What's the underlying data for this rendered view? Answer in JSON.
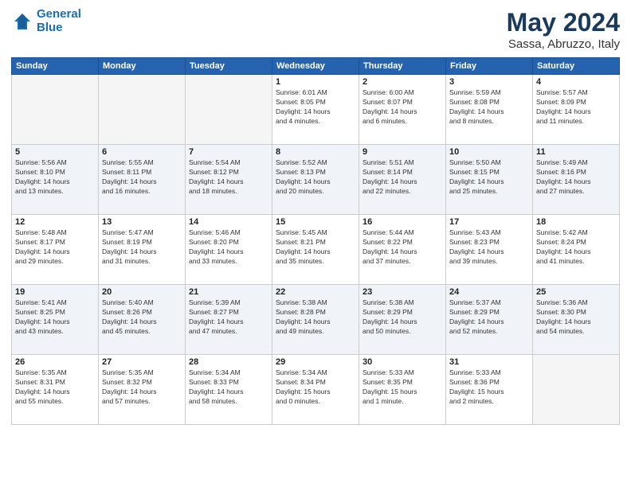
{
  "header": {
    "logo_line1": "General",
    "logo_line2": "Blue",
    "month": "May 2024",
    "location": "Sassa, Abruzzo, Italy"
  },
  "weekdays": [
    "Sunday",
    "Monday",
    "Tuesday",
    "Wednesday",
    "Thursday",
    "Friday",
    "Saturday"
  ],
  "weeks": [
    [
      {
        "day": "",
        "info": ""
      },
      {
        "day": "",
        "info": ""
      },
      {
        "day": "",
        "info": ""
      },
      {
        "day": "1",
        "info": "Sunrise: 6:01 AM\nSunset: 8:05 PM\nDaylight: 14 hours\nand 4 minutes."
      },
      {
        "day": "2",
        "info": "Sunrise: 6:00 AM\nSunset: 8:07 PM\nDaylight: 14 hours\nand 6 minutes."
      },
      {
        "day": "3",
        "info": "Sunrise: 5:59 AM\nSunset: 8:08 PM\nDaylight: 14 hours\nand 8 minutes."
      },
      {
        "day": "4",
        "info": "Sunrise: 5:57 AM\nSunset: 8:09 PM\nDaylight: 14 hours\nand 11 minutes."
      }
    ],
    [
      {
        "day": "5",
        "info": "Sunrise: 5:56 AM\nSunset: 8:10 PM\nDaylight: 14 hours\nand 13 minutes."
      },
      {
        "day": "6",
        "info": "Sunrise: 5:55 AM\nSunset: 8:11 PM\nDaylight: 14 hours\nand 16 minutes."
      },
      {
        "day": "7",
        "info": "Sunrise: 5:54 AM\nSunset: 8:12 PM\nDaylight: 14 hours\nand 18 minutes."
      },
      {
        "day": "8",
        "info": "Sunrise: 5:52 AM\nSunset: 8:13 PM\nDaylight: 14 hours\nand 20 minutes."
      },
      {
        "day": "9",
        "info": "Sunrise: 5:51 AM\nSunset: 8:14 PM\nDaylight: 14 hours\nand 22 minutes."
      },
      {
        "day": "10",
        "info": "Sunrise: 5:50 AM\nSunset: 8:15 PM\nDaylight: 14 hours\nand 25 minutes."
      },
      {
        "day": "11",
        "info": "Sunrise: 5:49 AM\nSunset: 8:16 PM\nDaylight: 14 hours\nand 27 minutes."
      }
    ],
    [
      {
        "day": "12",
        "info": "Sunrise: 5:48 AM\nSunset: 8:17 PM\nDaylight: 14 hours\nand 29 minutes."
      },
      {
        "day": "13",
        "info": "Sunrise: 5:47 AM\nSunset: 8:19 PM\nDaylight: 14 hours\nand 31 minutes."
      },
      {
        "day": "14",
        "info": "Sunrise: 5:46 AM\nSunset: 8:20 PM\nDaylight: 14 hours\nand 33 minutes."
      },
      {
        "day": "15",
        "info": "Sunrise: 5:45 AM\nSunset: 8:21 PM\nDaylight: 14 hours\nand 35 minutes."
      },
      {
        "day": "16",
        "info": "Sunrise: 5:44 AM\nSunset: 8:22 PM\nDaylight: 14 hours\nand 37 minutes."
      },
      {
        "day": "17",
        "info": "Sunrise: 5:43 AM\nSunset: 8:23 PM\nDaylight: 14 hours\nand 39 minutes."
      },
      {
        "day": "18",
        "info": "Sunrise: 5:42 AM\nSunset: 8:24 PM\nDaylight: 14 hours\nand 41 minutes."
      }
    ],
    [
      {
        "day": "19",
        "info": "Sunrise: 5:41 AM\nSunset: 8:25 PM\nDaylight: 14 hours\nand 43 minutes."
      },
      {
        "day": "20",
        "info": "Sunrise: 5:40 AM\nSunset: 8:26 PM\nDaylight: 14 hours\nand 45 minutes."
      },
      {
        "day": "21",
        "info": "Sunrise: 5:39 AM\nSunset: 8:27 PM\nDaylight: 14 hours\nand 47 minutes."
      },
      {
        "day": "22",
        "info": "Sunrise: 5:38 AM\nSunset: 8:28 PM\nDaylight: 14 hours\nand 49 minutes."
      },
      {
        "day": "23",
        "info": "Sunrise: 5:38 AM\nSunset: 8:29 PM\nDaylight: 14 hours\nand 50 minutes."
      },
      {
        "day": "24",
        "info": "Sunrise: 5:37 AM\nSunset: 8:29 PM\nDaylight: 14 hours\nand 52 minutes."
      },
      {
        "day": "25",
        "info": "Sunrise: 5:36 AM\nSunset: 8:30 PM\nDaylight: 14 hours\nand 54 minutes."
      }
    ],
    [
      {
        "day": "26",
        "info": "Sunrise: 5:35 AM\nSunset: 8:31 PM\nDaylight: 14 hours\nand 55 minutes."
      },
      {
        "day": "27",
        "info": "Sunrise: 5:35 AM\nSunset: 8:32 PM\nDaylight: 14 hours\nand 57 minutes."
      },
      {
        "day": "28",
        "info": "Sunrise: 5:34 AM\nSunset: 8:33 PM\nDaylight: 14 hours\nand 58 minutes."
      },
      {
        "day": "29",
        "info": "Sunrise: 5:34 AM\nSunset: 8:34 PM\nDaylight: 15 hours\nand 0 minutes."
      },
      {
        "day": "30",
        "info": "Sunrise: 5:33 AM\nSunset: 8:35 PM\nDaylight: 15 hours\nand 1 minute."
      },
      {
        "day": "31",
        "info": "Sunrise: 5:33 AM\nSunset: 8:36 PM\nDaylight: 15 hours\nand 2 minutes."
      },
      {
        "day": "",
        "info": ""
      }
    ]
  ]
}
